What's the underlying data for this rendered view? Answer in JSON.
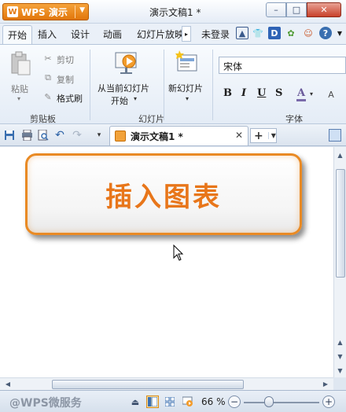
{
  "titlebar": {
    "app_name": "WPS 演示",
    "doc_title": "演示文稿1 *",
    "minimize": "–",
    "maximize": "□",
    "close": "✕"
  },
  "menu": {
    "tabs": [
      "开始",
      "插入",
      "设计",
      "动画",
      "幻灯片放映"
    ],
    "login": "未登录"
  },
  "ribbon": {
    "clipboard": {
      "paste": "粘贴",
      "cut": "剪切",
      "copy": "复制",
      "format_painter": "格式刷",
      "group_label": "剪贴板"
    },
    "slides": {
      "from_current_line1": "从当前幻灯片",
      "from_current_line2": "开始",
      "new_slide": "新幻灯片",
      "group_label": "幻灯片"
    },
    "font": {
      "font_name": "宋体",
      "bold": "B",
      "italic": "I",
      "underline": "U",
      "strike": "S",
      "color": "A",
      "group_label": "字体"
    }
  },
  "document_tab": {
    "label": "演示文稿1 *",
    "close": "✕",
    "new_tab": "+"
  },
  "slide": {
    "title_text": "插入图表"
  },
  "status": {
    "watermark": "@WPS微服务",
    "zoom": "66 %",
    "zoom_minus": "−",
    "zoom_plus": "+"
  },
  "colors": {
    "accent": "#e8761a",
    "app_button": "#e88a1f"
  }
}
